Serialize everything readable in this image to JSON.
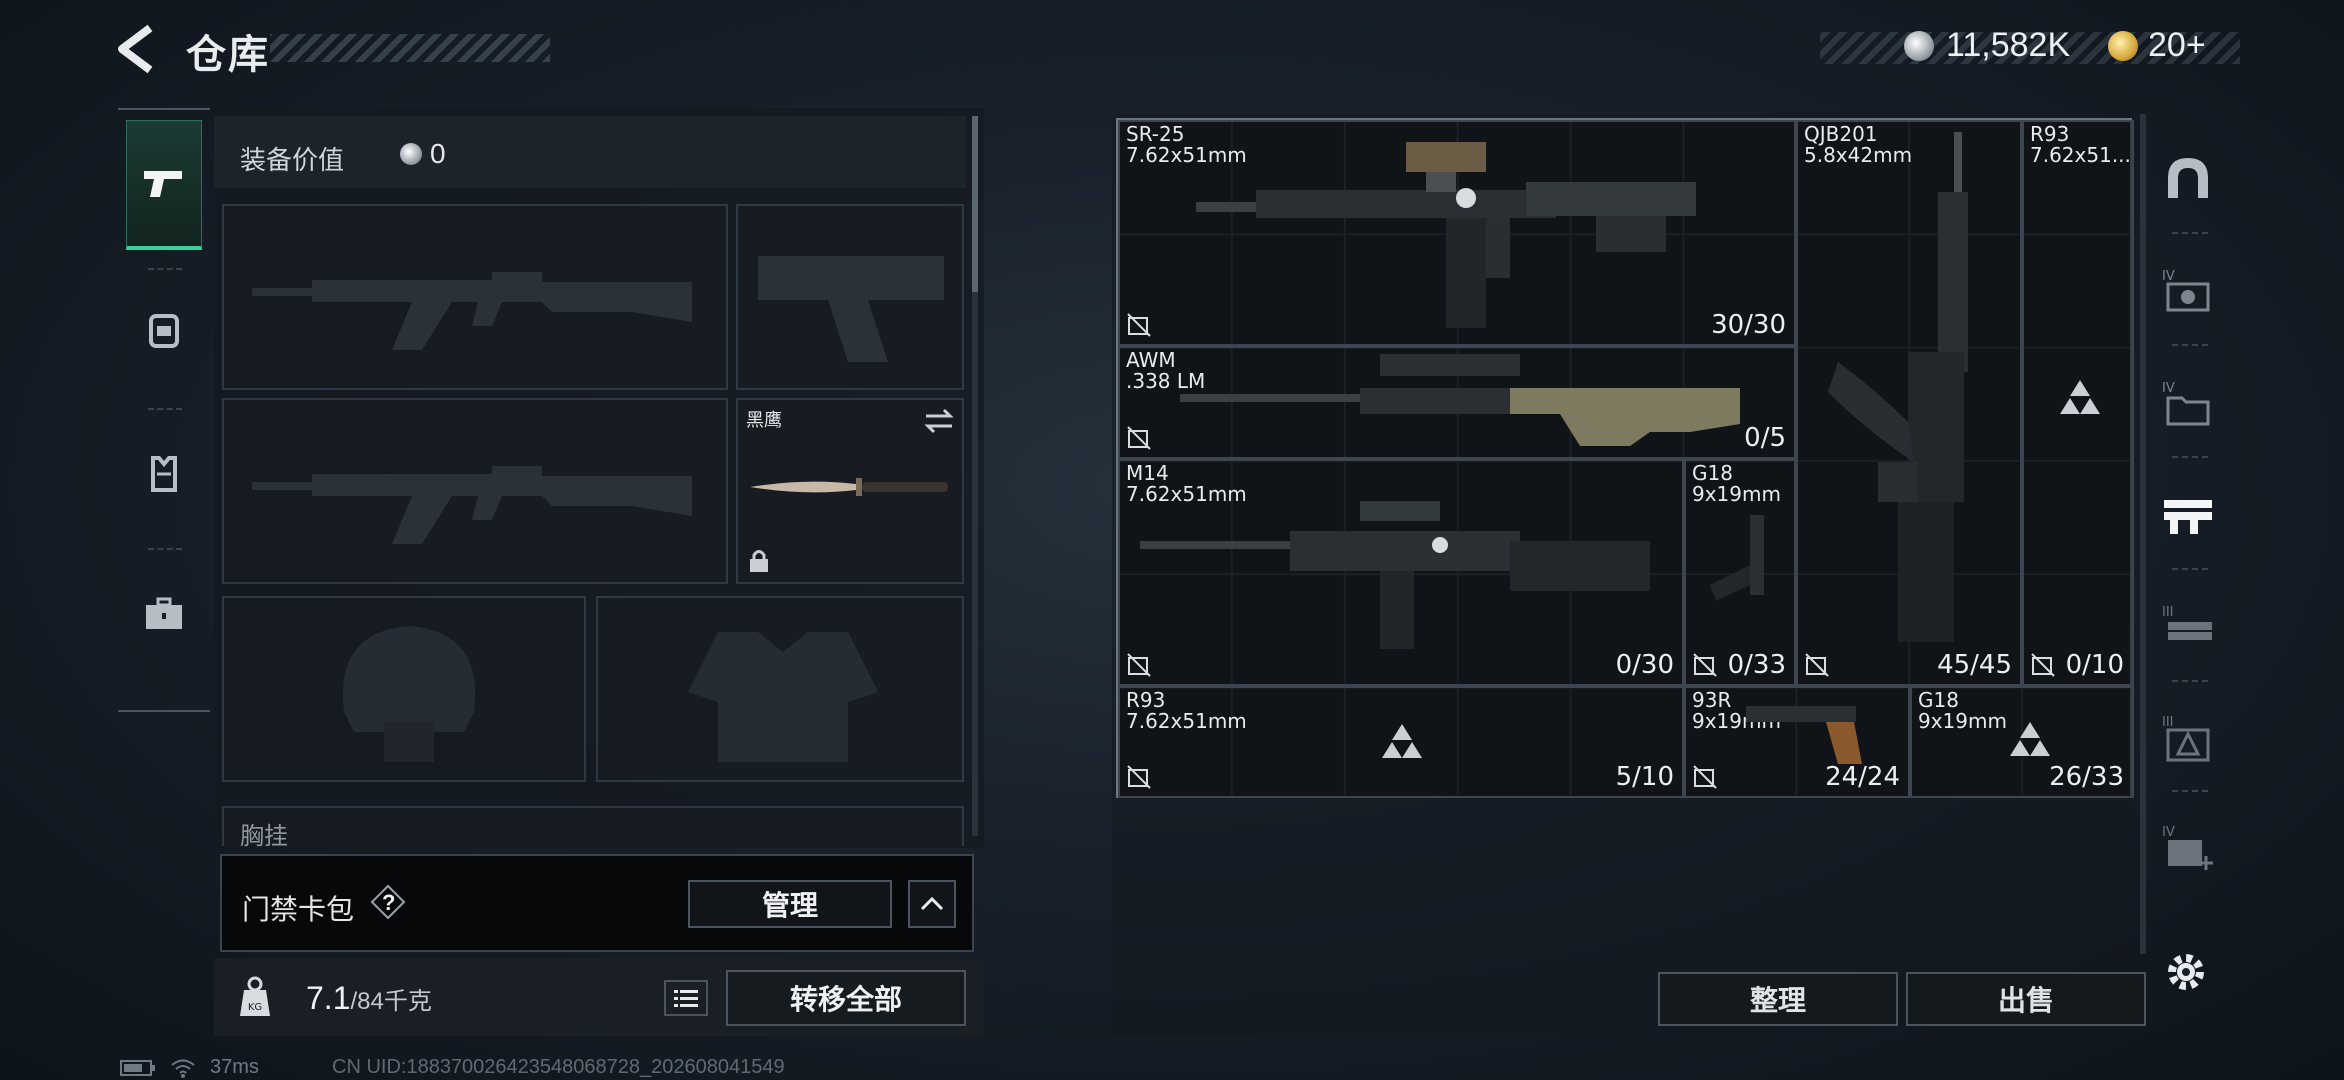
{
  "header": {
    "title": "仓库",
    "money": "11,582K",
    "tickets": "20+"
  },
  "left_nav": {
    "items": [
      "weapons",
      "backpack",
      "vest",
      "case"
    ]
  },
  "equipment": {
    "value_label": "装备价值",
    "value": "0",
    "melee_name": "黑鹰",
    "next_section_label": "胸挂"
  },
  "card_bar": {
    "label": "门禁卡包",
    "help": "?",
    "manage": "管理"
  },
  "weight": {
    "current": "7.1",
    "max": "/84千克"
  },
  "actions": {
    "transfer_all": "转移全部",
    "sort": "整理",
    "sell": "出售"
  },
  "warehouse": {
    "items": [
      {
        "name": "SR-25",
        "caliber": "7.62x51mm",
        "count": "30/30"
      },
      {
        "name": "QJB201",
        "caliber": "5.8x42mm",
        "count": "45/45"
      },
      {
        "name": "R93",
        "caliber": "7.62x51...",
        "count": "0/10"
      },
      {
        "name": "AWM",
        "caliber": ".338 LM",
        "count": "0/5"
      },
      {
        "name": "M14",
        "caliber": "7.62x51mm",
        "count": "0/30"
      },
      {
        "name": "G18",
        "caliber": "9x19mm",
        "count": "0/33"
      },
      {
        "name": "R93",
        "caliber": "7.62x51mm",
        "count": "5/10"
      },
      {
        "name": "93R",
        "caliber": "9x19mm",
        "count": "24/24"
      },
      {
        "name": "G18",
        "caliber": "9x19mm",
        "count": "26/33"
      }
    ]
  },
  "footer": {
    "ping": "37ms",
    "uid": "CN UID:1883700264235480687​28_202608041549"
  },
  "colors": {
    "accent": "#3ad09a",
    "panel": "#141a20",
    "border": "#4a5560"
  }
}
